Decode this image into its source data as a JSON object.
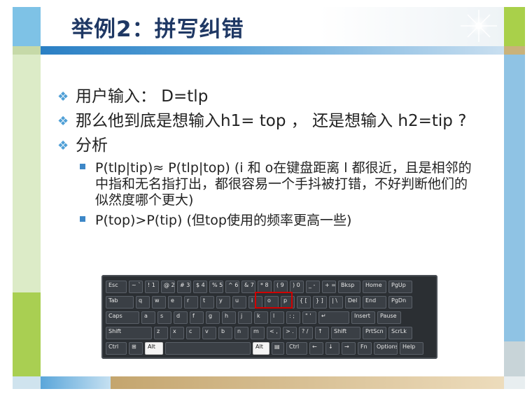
{
  "slide": {
    "title": "举例2：拼写纠错",
    "bullets": [
      {
        "text": "用户输入：  D=tlp",
        "level": 1
      },
      {
        "text": "那么他到底是想输入h1= top ， 还是想输入 h2=tip ?",
        "level": 1
      },
      {
        "text": "分析",
        "level": 1
      },
      {
        "text": "P(tlp|tip)≈ P(tlp|top) (i 和 o在键盘距离 l 都很近，且是相邻的中指和无名指打出，都很容易一个手抖被打错，不好判断他们的似然度哪个更大)",
        "level": 2
      },
      {
        "text": "P(top)>P(tip) (但top使用的频率更高一些)",
        "level": 2
      }
    ],
    "colors": {
      "title": "#1f3864",
      "diamond_bullet": "#4f9fd6",
      "square_bullet": "#3d87c7",
      "highlight": "#d00000"
    }
  },
  "keyboard": {
    "rows": [
      [
        "Esc",
        "~ `",
        "! 1",
        "@ 2",
        "# 3",
        "$ 4",
        "% 5",
        "^ 6",
        "& 7",
        "* 8",
        "( 9",
        ") 0",
        "_ -",
        "+ =",
        "Bksp",
        "Home",
        "PgUp"
      ],
      [
        "Tab",
        "q",
        "w",
        "e",
        "r",
        "t",
        "y",
        "u",
        "i",
        "o",
        "p",
        "{ [",
        "} ]",
        "| \\",
        "Del",
        "End",
        "PgDn"
      ],
      [
        "Caps",
        "a",
        "s",
        "d",
        "f",
        "g",
        "h",
        "j",
        "k",
        "l",
        ": ;",
        "\" '",
        "↵",
        "Insert",
        "Pause"
      ],
      [
        "Shift",
        "z",
        "x",
        "c",
        "v",
        "b",
        "n",
        "m",
        "< ,",
        "> .",
        "? /",
        "↑",
        "Shift",
        "PrtScn",
        "ScrLk"
      ],
      [
        "Ctrl",
        "⊞",
        "Alt",
        "",
        "Alt",
        "▤",
        "Ctrl",
        "←",
        "↓",
        "→",
        "Fn",
        "Options",
        "Help"
      ]
    ],
    "highlighted_keys": [
      "i",
      "o"
    ]
  }
}
